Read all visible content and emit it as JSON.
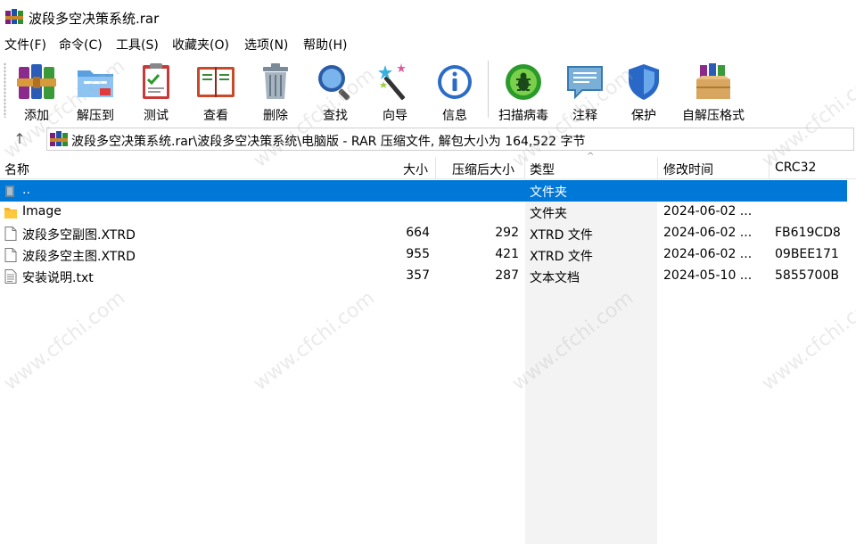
{
  "window": {
    "title": "波段多空决策系统.rar"
  },
  "menu": [
    "文件(F)",
    "命令(C)",
    "工具(S)",
    "收藏夹(O)",
    "选项(N)",
    "帮助(H)"
  ],
  "toolbar": [
    {
      "label": "添加",
      "icon": "add-books-icon"
    },
    {
      "label": "解压到",
      "icon": "extract-folder-icon"
    },
    {
      "label": "测试",
      "icon": "test-checklist-icon"
    },
    {
      "label": "查看",
      "icon": "view-book-icon"
    },
    {
      "label": "删除",
      "icon": "trash-icon"
    },
    {
      "label": "查找",
      "icon": "magnifier-icon"
    },
    {
      "label": "向导",
      "icon": "wizard-wand-icon"
    },
    {
      "label": "信息",
      "icon": "info-icon"
    },
    {
      "label": "扫描病毒",
      "icon": "bug-scan-icon"
    },
    {
      "label": "注释",
      "icon": "comment-icon"
    },
    {
      "label": "保护",
      "icon": "shield-icon"
    },
    {
      "label": "自解压格式",
      "icon": "sfx-box-icon"
    }
  ],
  "address": {
    "path": "波段多空决策系统.rar\\波段多空决策系统\\电脑版 - RAR 压缩文件, 解包大小为 164,522 字节"
  },
  "columns": {
    "name": "名称",
    "size": "大小",
    "packed": "压缩后大小",
    "type": "类型",
    "mtime": "修改时间",
    "crc": "CRC32"
  },
  "files": [
    {
      "name": "..",
      "size": "",
      "packed": "",
      "type": "文件夹",
      "mtime": "",
      "crc": "",
      "icon": "parent-folder-icon",
      "selected": true
    },
    {
      "name": "Image",
      "size": "",
      "packed": "",
      "type": "文件夹",
      "mtime": "2024-06-02 ...",
      "crc": "",
      "icon": "folder-icon",
      "selected": false
    },
    {
      "name": "波段多空副图.XTRD",
      "size": "664",
      "packed": "292",
      "type": "XTRD 文件",
      "mtime": "2024-06-02 ...",
      "crc": "FB619CD8",
      "icon": "file-icon",
      "selected": false
    },
    {
      "name": "波段多空主图.XTRD",
      "size": "955",
      "packed": "421",
      "type": "XTRD 文件",
      "mtime": "2024-06-02 ...",
      "crc": "09BEE171",
      "icon": "file-icon",
      "selected": false
    },
    {
      "name": "安装说明.txt",
      "size": "357",
      "packed": "287",
      "type": "文本文档",
      "mtime": "2024-05-10 ...",
      "crc": "5855700B",
      "icon": "text-file-icon",
      "selected": false
    }
  ],
  "watermark": "www.cfchi.com",
  "colors": {
    "selection": "#0078d7",
    "sorted_column": "#f3f3f3"
  }
}
